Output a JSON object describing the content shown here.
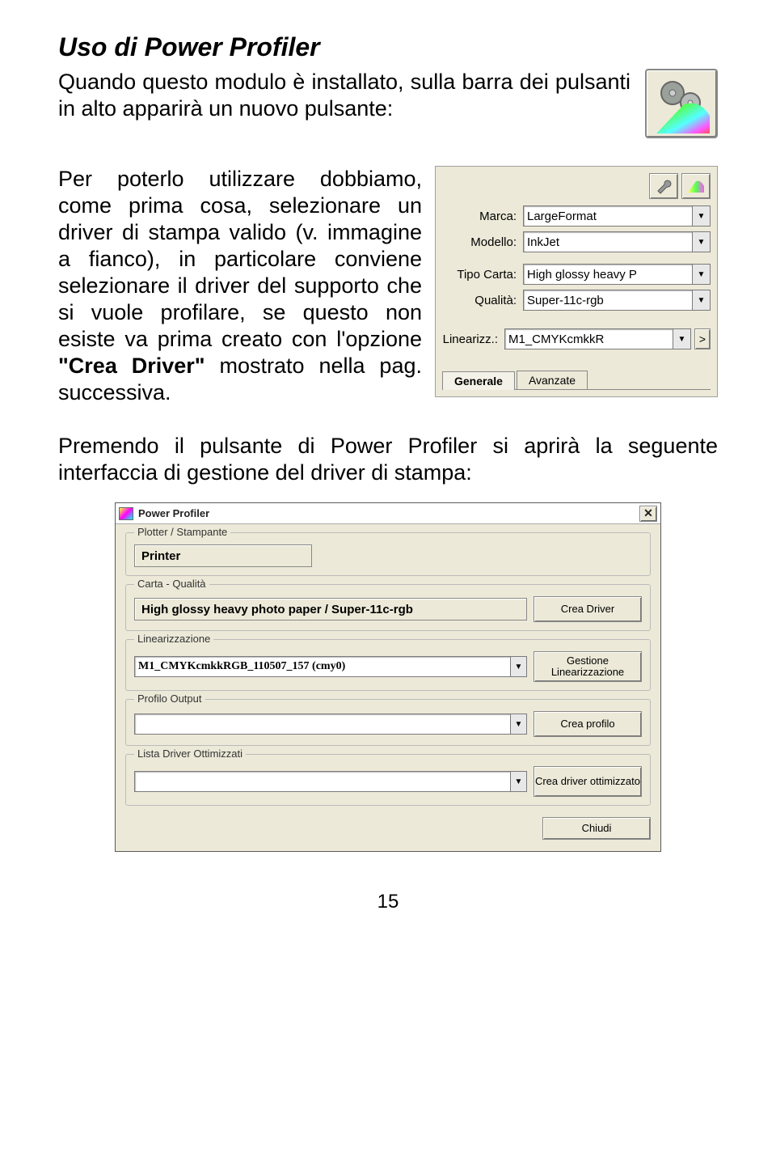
{
  "title": "Uso di Power Profiler",
  "intro": "Quando questo modulo è installato, sulla barra dei pulsanti in alto apparirà un nuovo pulsante:",
  "paragraph1_parts": {
    "p1": "Per poterlo utilizzare dobbiamo, come prima cosa, selezionare un driver di stampa valido (v. immagine a fianco), in particolare conviene selezionare il driver del supporto che si vuole profilare, se questo non esiste va prima creato con l'opzione ",
    "strong": "\"Crea Driver\"",
    "p2": " mostrato nella pag. successiva."
  },
  "panel": {
    "rows": {
      "marca": {
        "label": "Marca:",
        "value": "LargeFormat"
      },
      "modello": {
        "label": "Modello:",
        "value": "InkJet"
      },
      "tipo": {
        "label": "Tipo Carta:",
        "value": "High glossy heavy P"
      },
      "qualita": {
        "label": "Qualità:",
        "value": "Super-11c-rgb"
      },
      "lineariz": {
        "label": "Linearizz.:",
        "value": "M1_CMYKcmkkR"
      }
    },
    "tabs": {
      "generale": "Generale",
      "avanzate": "Avanzate"
    },
    "gt": ">"
  },
  "paragraph2": "Premendo il pulsante di Power Profiler si aprirà la seguente interfaccia di gestione del driver di stampa:",
  "dialog": {
    "title": "Power Profiler",
    "close": "✕",
    "groups": {
      "plotter": {
        "legend": "Plotter / Stampante",
        "value": "Printer"
      },
      "carta": {
        "legend": "Carta - Qualità",
        "value": "High glossy heavy photo paper / Super-11c-rgb",
        "btn": "Crea Driver"
      },
      "lineariz": {
        "legend": "Linearizzazione",
        "value": "M1_CMYKcmkkRGB_110507_157 (cmy0)",
        "btn": "Gestione Linearizzazione"
      },
      "profilo": {
        "legend": "Profilo Output",
        "value": "",
        "btn": "Crea profilo"
      },
      "lista": {
        "legend": "Lista Driver Ottimizzati",
        "value": "",
        "btn": "Crea driver ottimizzato"
      }
    },
    "chiudi": "Chiudi"
  },
  "page_number": "15"
}
